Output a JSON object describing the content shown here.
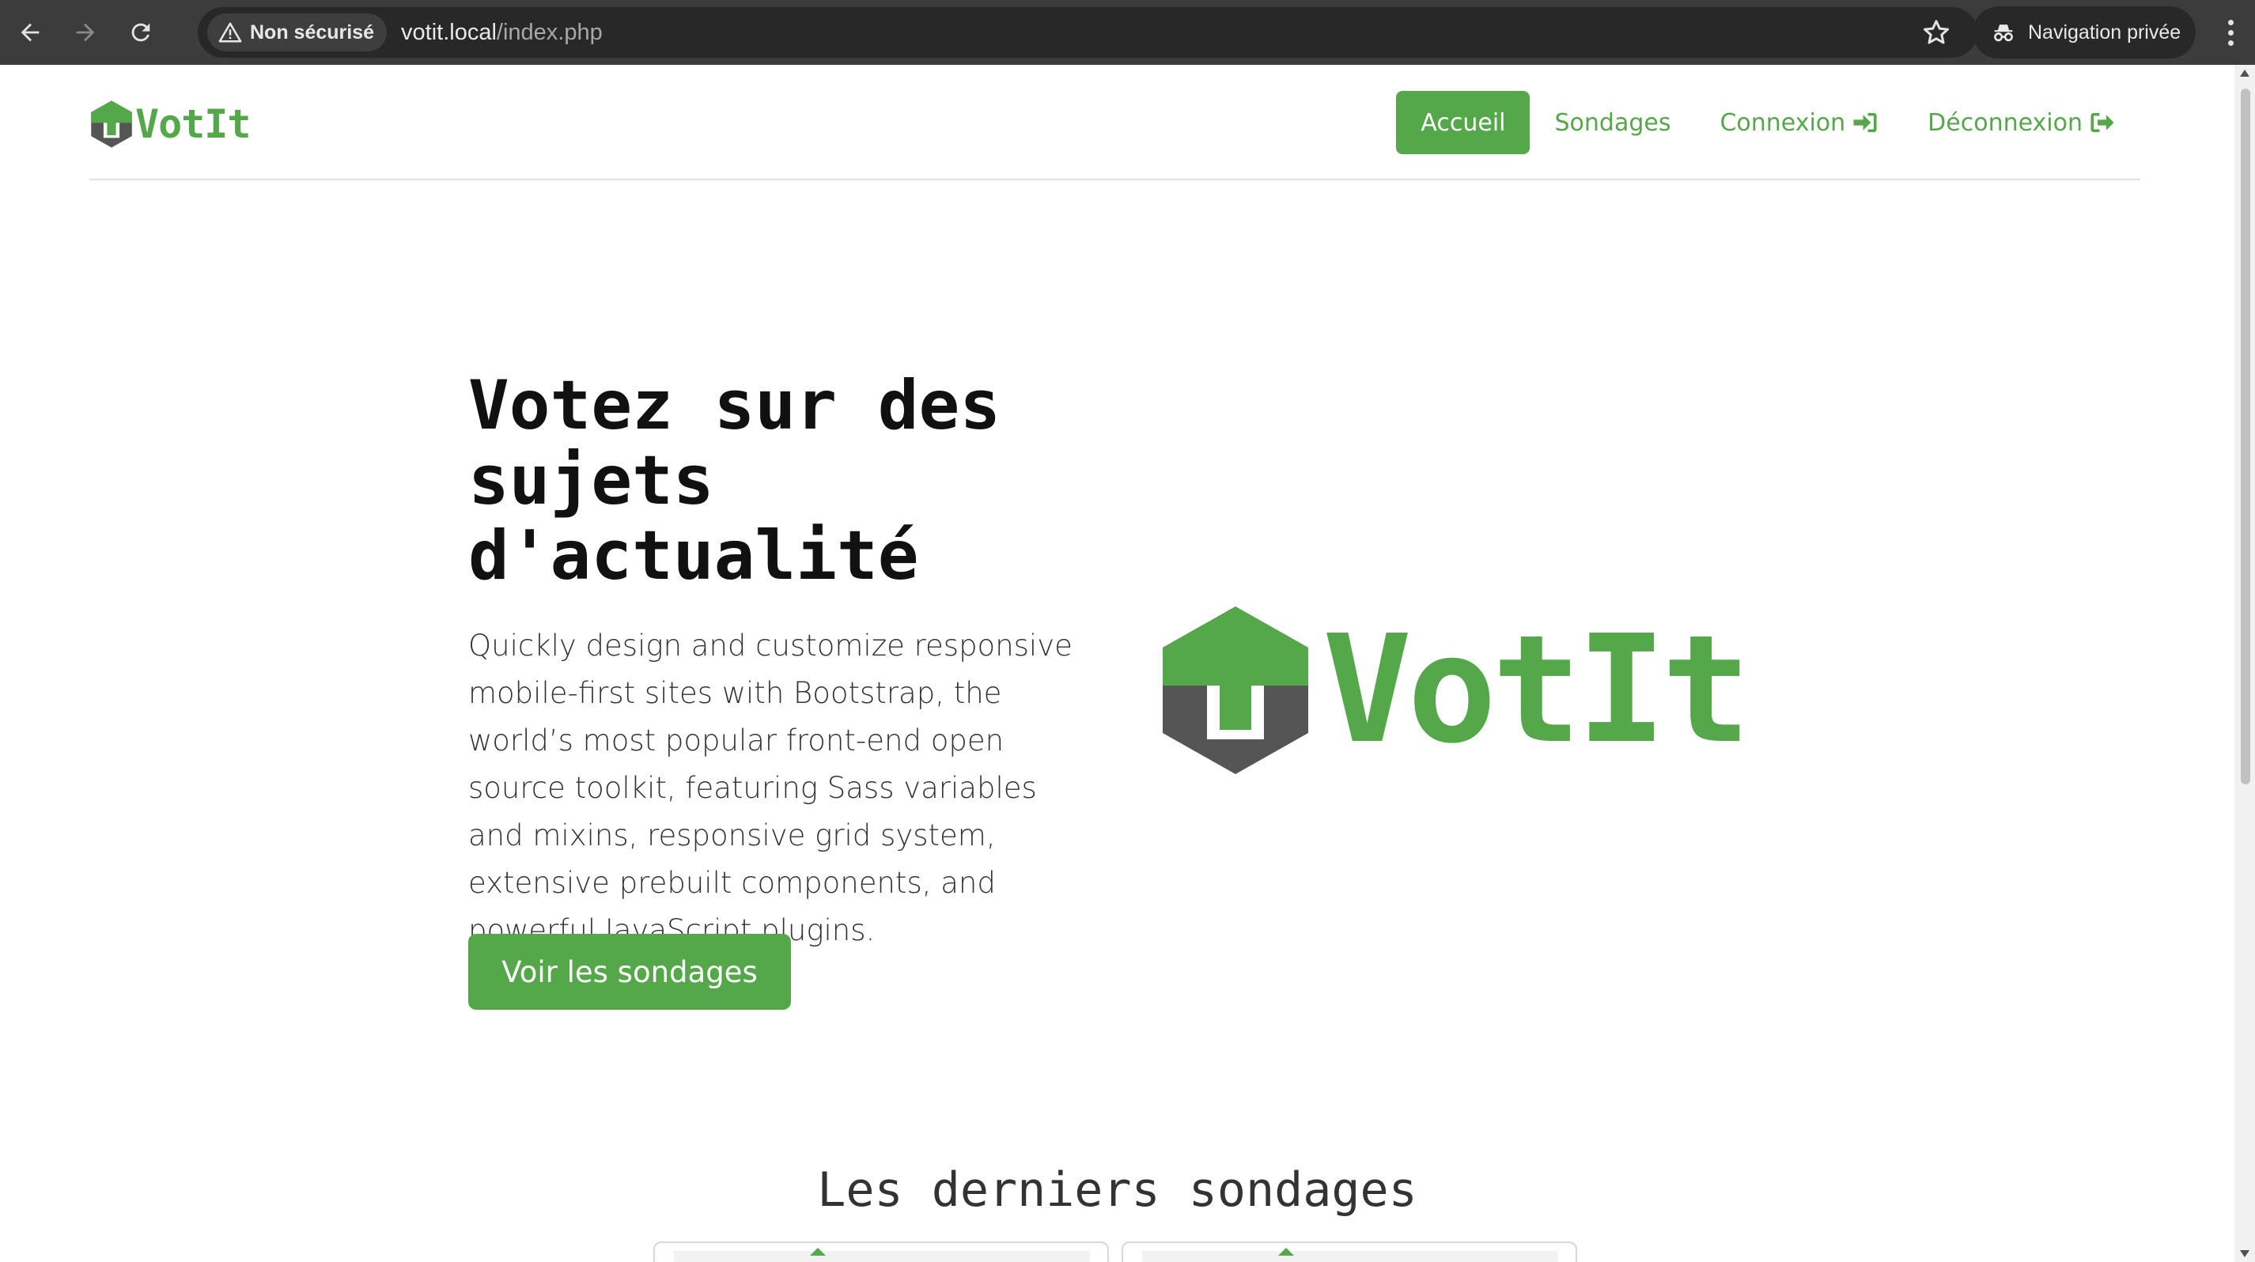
{
  "browser": {
    "security_label": "Non sécurisé",
    "url_host": "votit.local",
    "url_path": "/index.php",
    "incognito_label": "Navigation privée"
  },
  "header": {
    "brand": "VotIt",
    "nav": [
      {
        "label": "Accueil",
        "active": true
      },
      {
        "label": "Sondages",
        "active": false
      },
      {
        "label": "Connexion",
        "active": false
      },
      {
        "label": "Déconnexion",
        "active": false
      }
    ]
  },
  "hero": {
    "title_line1": "Votez sur des",
    "title_line2": "sujets",
    "title_line3": "d'actualité",
    "lead": "Quickly design and customize responsive mobile-first sites with Bootstrap, the world’s most popular front-end open source toolkit, featuring Sass variables and mixins, responsive grid system, extensive prebuilt components, and powerful JavaScript plugins.",
    "button_label": "Voir les sondages",
    "logo_text": "VotIt"
  },
  "latest": {
    "title": "Les derniers sondages"
  },
  "colors": {
    "brand_green": "#55a84a",
    "logo_gray": "#555555",
    "chrome_dark": "#3c3c3c"
  },
  "icons": {
    "back": "arrow-left-icon",
    "forward": "arrow-right-icon",
    "reload": "reload-icon",
    "warning": "warning-triangle-icon",
    "star": "star-icon",
    "incognito": "incognito-icon",
    "login": "sign-in-icon",
    "logout": "sign-out-icon"
  }
}
